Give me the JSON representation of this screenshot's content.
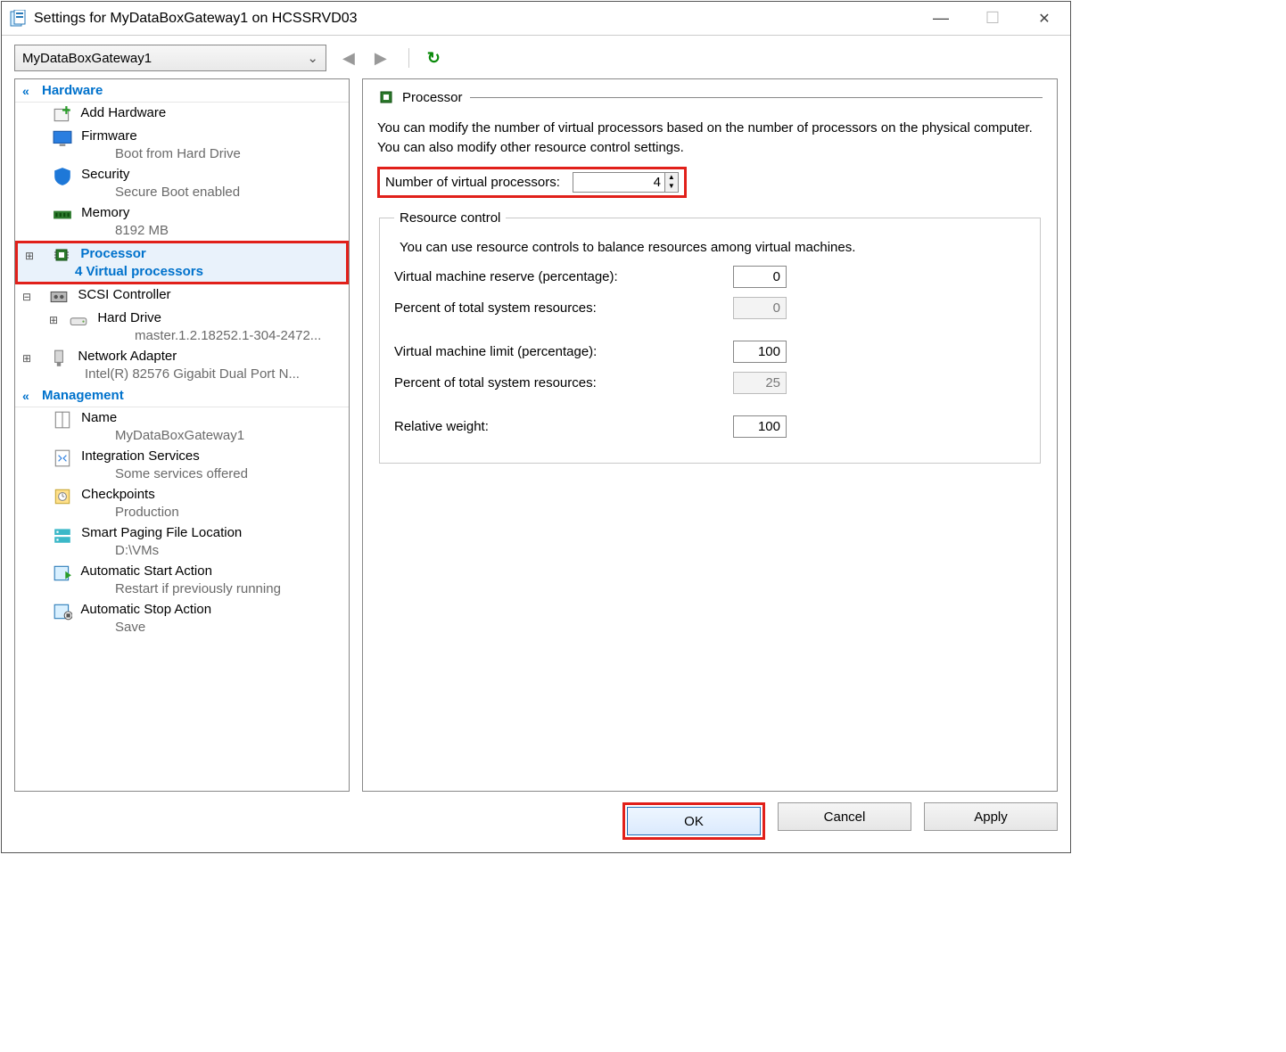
{
  "window": {
    "title": "Settings for MyDataBoxGateway1 on HCSSRVD03"
  },
  "vm_dropdown": {
    "selected": "MyDataBoxGateway1"
  },
  "sections": {
    "hardware": {
      "header": "Hardware",
      "items": {
        "add_hardware": {
          "label": "Add Hardware"
        },
        "firmware": {
          "label": "Firmware",
          "sub": "Boot from Hard Drive"
        },
        "security": {
          "label": "Security",
          "sub": "Secure Boot enabled"
        },
        "memory": {
          "label": "Memory",
          "sub": "8192 MB"
        },
        "processor": {
          "label": "Processor",
          "sub": "4 Virtual processors"
        },
        "scsi": {
          "label": "SCSI Controller"
        },
        "hard_drive": {
          "label": "Hard Drive",
          "sub": "master.1.2.18252.1-304-2472..."
        },
        "network": {
          "label": "Network Adapter",
          "sub": "Intel(R) 82576 Gigabit Dual Port N..."
        }
      }
    },
    "management": {
      "header": "Management",
      "items": {
        "name": {
          "label": "Name",
          "sub": "MyDataBoxGateway1"
        },
        "integration": {
          "label": "Integration Services",
          "sub": "Some services offered"
        },
        "checkpoints": {
          "label": "Checkpoints",
          "sub": "Production"
        },
        "smart_paging": {
          "label": "Smart Paging File Location",
          "sub": "D:\\VMs"
        },
        "auto_start": {
          "label": "Automatic Start Action",
          "sub": "Restart if previously running"
        },
        "auto_stop": {
          "label": "Automatic Stop Action",
          "sub": "Save"
        }
      }
    }
  },
  "panel": {
    "title": "Processor",
    "description": "You can modify the number of virtual processors based on the number of processors on the physical computer. You can also modify other resource control settings.",
    "vproc_label": "Number of virtual processors:",
    "vproc_value": "4",
    "resource_control": {
      "legend": "Resource control",
      "description": "You can use resource controls to balance resources among virtual machines.",
      "reserve_label": "Virtual machine reserve (percentage):",
      "reserve_value": "0",
      "reserve_total_label": "Percent of total system resources:",
      "reserve_total_value": "0",
      "limit_label": "Virtual machine limit (percentage):",
      "limit_value": "100",
      "limit_total_label": "Percent of total system resources:",
      "limit_total_value": "25",
      "weight_label": "Relative weight:",
      "weight_value": "100"
    }
  },
  "buttons": {
    "ok": "OK",
    "cancel": "Cancel",
    "apply": "Apply"
  }
}
